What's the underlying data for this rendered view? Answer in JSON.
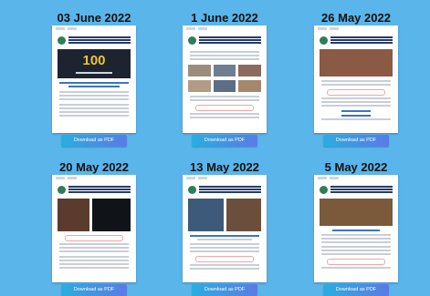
{
  "newsletters": [
    {
      "date": "03 June 2022",
      "button": "Download as PDF",
      "hero_text": "100",
      "style": "blue"
    },
    {
      "date": "1 June 2022",
      "button": "Download as PDF",
      "style": "grid"
    },
    {
      "date": "26 May 2022",
      "button": "Download as PDF",
      "style": "photo"
    },
    {
      "date": "20 May 2022",
      "button": "Download as PDF",
      "style": "dark"
    },
    {
      "date": "13 May 2022",
      "button": "Download as PDF",
      "style": "group"
    },
    {
      "date": "5 May 2022",
      "button": "Download as PDF",
      "style": "class"
    }
  ],
  "colors": {
    "background": "#5ab5ea",
    "button_start": "#29aee0",
    "button_end": "#5a7be6"
  }
}
